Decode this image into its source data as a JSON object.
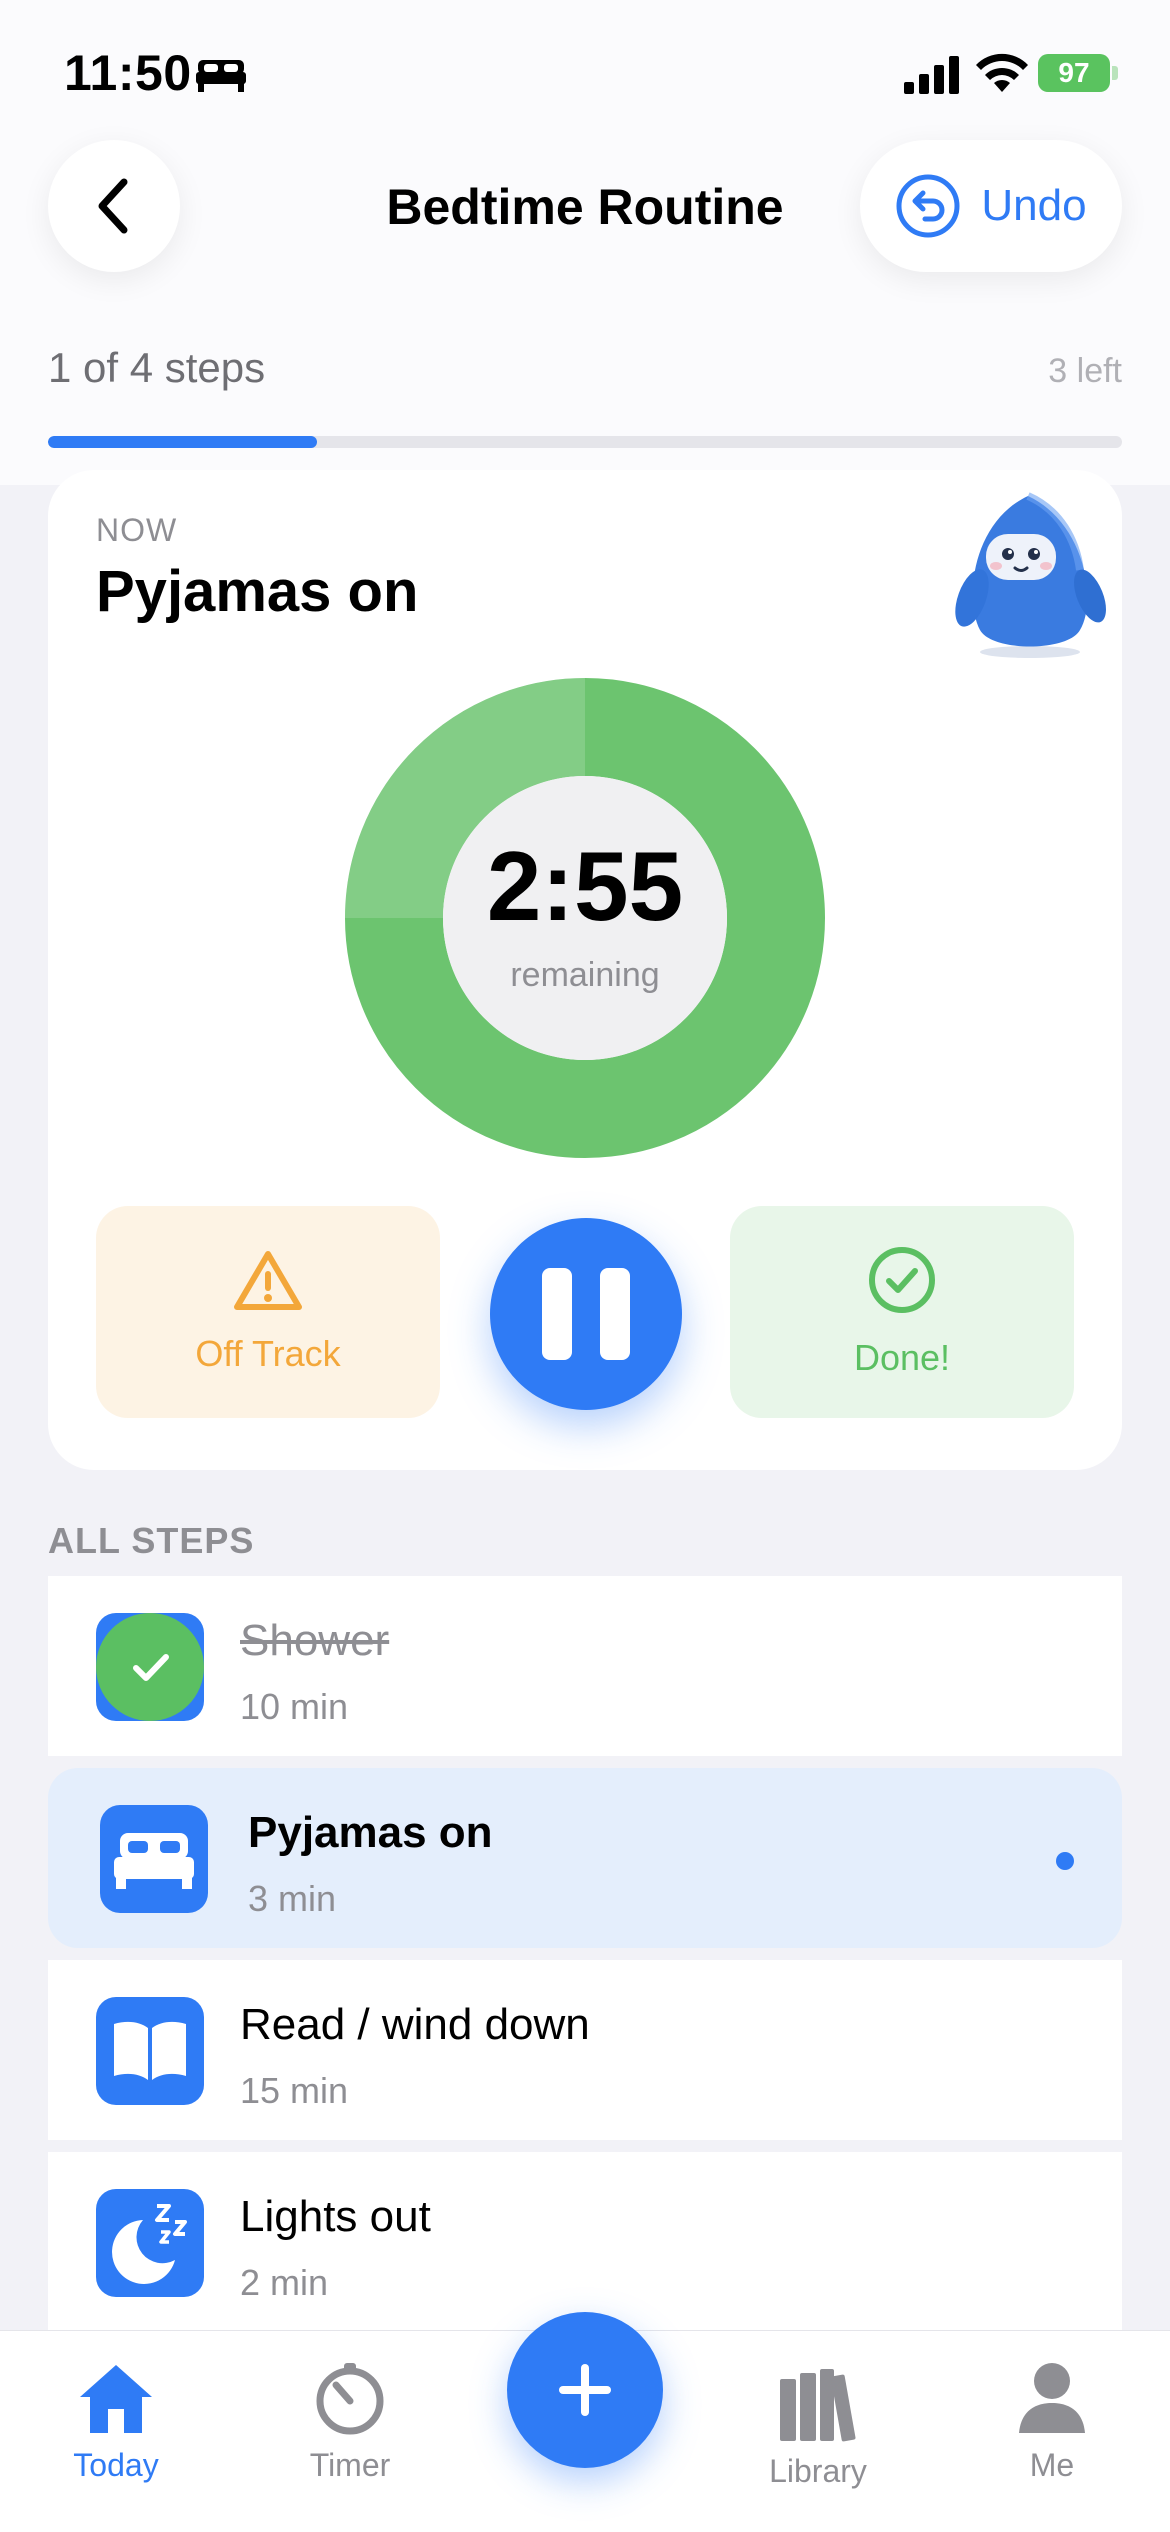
{
  "status_bar": {
    "time": "11:50",
    "battery": "97"
  },
  "header": {
    "title": "Bedtime Routine",
    "undo_label": "Undo"
  },
  "progress": {
    "label": "1 of 4 steps",
    "remaining": "3 left",
    "fraction": 0.25
  },
  "now": {
    "label": "NOW",
    "title": "Pyjamas on",
    "timer": "2:55",
    "timer_sub": "remaining",
    "off_track_label": "Off Track",
    "done_label": "Done!"
  },
  "steps_section": {
    "label": "ALL STEPS",
    "items": [
      {
        "name": "Shower",
        "duration": "10 min",
        "status": "done",
        "icon": "check-icon"
      },
      {
        "name": "Pyjamas on",
        "duration": "3 min",
        "status": "current",
        "icon": "bed-icon"
      },
      {
        "name": "Read / wind down",
        "duration": "15 min",
        "status": "pending",
        "icon": "book-icon"
      },
      {
        "name": "Lights out",
        "duration": "2 min",
        "status": "pending",
        "icon": "moon-sleep-icon"
      }
    ]
  },
  "tabbar": {
    "tabs": [
      {
        "label": "Today",
        "icon": "house-icon",
        "active": true
      },
      {
        "label": "Timer",
        "icon": "timer-icon",
        "active": false
      },
      {
        "label": "Library",
        "icon": "books-icon",
        "active": false
      },
      {
        "label": "Me",
        "icon": "person-icon",
        "active": false
      }
    ],
    "add_icon": "plus-icon"
  },
  "colors": {
    "accent": "#2f7bf5",
    "success": "#5bbf62",
    "warning": "#f3a73a",
    "ring": "#6cc46f"
  }
}
